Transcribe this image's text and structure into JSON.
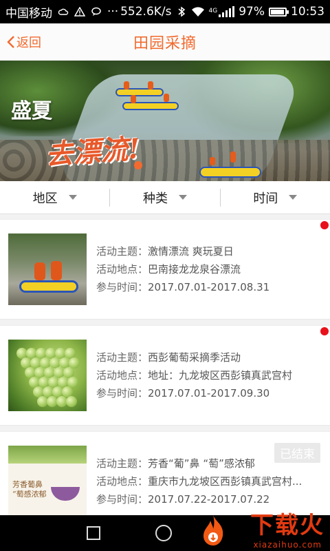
{
  "status_bar": {
    "carrier": "中国移动",
    "speed": "552.6K/s",
    "network": "4G",
    "battery": "97%",
    "battery_level": 0.97,
    "time": "10:53",
    "icons": [
      "weather-icon",
      "warning-icon",
      "message-icon",
      "more-icon",
      "bluetooth-icon",
      "wifi-icon",
      "signal-icon",
      "battery-icon"
    ]
  },
  "header": {
    "back_label": "返回",
    "title": "田园采摘"
  },
  "banner": {
    "line1": "盛夏",
    "line2": "去漂流!"
  },
  "filters": [
    {
      "label": "地区"
    },
    {
      "label": "种类"
    },
    {
      "label": "时间"
    }
  ],
  "activities": [
    {
      "theme_label": "活动主题：",
      "theme": "激情漂流 爽玩夏日",
      "place_label": "活动地点：",
      "place": "巴南接龙龙泉谷漂流",
      "time_label": "参与时间：",
      "time": "2017.07.01-2017.08.31",
      "is_new": true,
      "ended": ""
    },
    {
      "theme_label": "活动主题：",
      "theme": "西彭葡萄采摘季活动",
      "place_label": "活动地点：",
      "place": "地址：九龙坡区西彭镇真武宫村",
      "time_label": "参与时间：",
      "time": "2017.07.01-2017.09.30",
      "is_new": true,
      "ended": ""
    },
    {
      "theme_label": "活动主题：",
      "theme": "芳香“葡”鼻 “萄”感浓郁",
      "place_label": "活动地点：",
      "place": "重庆市九龙坡区西彭镇真武宫村...",
      "time_label": "参与时间：",
      "time": "2017.07.22-2017.07.22",
      "is_new": false,
      "ended": "已结束",
      "poster_text": "芳香葡鼻 “萄感浓郁"
    }
  ],
  "watermark": {
    "text": "下载火",
    "url": "xiazaihuo.com"
  },
  "colors": {
    "accent": "#f26a2e",
    "new_dot": "#e8111b",
    "watermark": "#e23a10"
  }
}
